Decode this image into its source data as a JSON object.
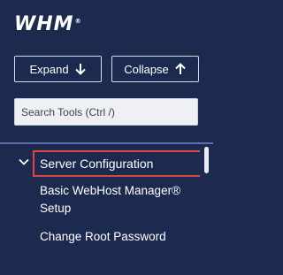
{
  "header": {
    "logo_text": "WHM",
    "logo_mark": "®"
  },
  "toolbar": {
    "expand_label": "Expand",
    "expand_icon": "arrow-down-icon",
    "collapse_label": "Collapse",
    "collapse_icon": "arrow-up-icon"
  },
  "search": {
    "placeholder": "Search Tools (Ctrl /)"
  },
  "sidebar": {
    "section": {
      "label": "Server Configuration",
      "icon": "chevron-down-icon",
      "expanded": true
    },
    "items": [
      {
        "label": "Basic WebHost Manager® Setup"
      },
      {
        "label": "Change Root Password"
      }
    ]
  },
  "colors": {
    "background": "#1b2a4e",
    "highlight_border": "#e04545",
    "divider": "#5d6ea8"
  }
}
